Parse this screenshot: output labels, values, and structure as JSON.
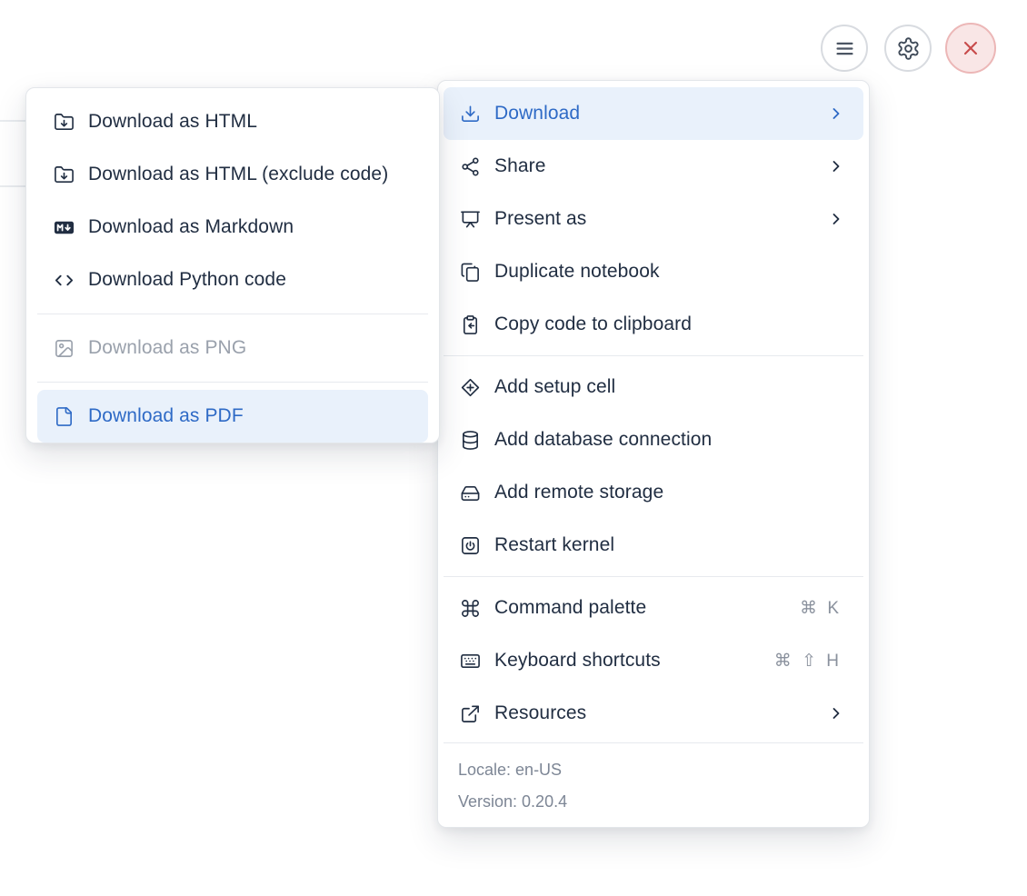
{
  "colors": {
    "accent_blue": "#2e6ac6",
    "highlight_bg": "#e9f1fb",
    "text": "#212e42",
    "muted": "#9aa1ac",
    "footer_text": "#7d8695",
    "danger": "#c84b4b",
    "danger_bg": "#f9e6e6"
  },
  "toolbar": {
    "buttons": [
      {
        "name": "menu",
        "icon": "hamburger-icon"
      },
      {
        "name": "settings",
        "icon": "gear-icon"
      },
      {
        "name": "close",
        "icon": "close-icon"
      }
    ]
  },
  "main_menu": {
    "items": [
      {
        "label": "Download",
        "icon": "download-icon",
        "has_submenu": true,
        "state": "active"
      },
      {
        "label": "Share",
        "icon": "share-icon",
        "has_submenu": true
      },
      {
        "label": "Present as",
        "icon": "presentation-icon",
        "has_submenu": true
      },
      {
        "label": "Duplicate notebook",
        "icon": "copy-pages-icon"
      },
      {
        "label": "Copy code to clipboard",
        "icon": "clipboard-arrow-icon"
      },
      {
        "label": "Add setup cell",
        "icon": "diamond-plus-icon"
      },
      {
        "label": "Add database connection",
        "icon": "database-icon"
      },
      {
        "label": "Add remote storage",
        "icon": "hard-drive-icon"
      },
      {
        "label": "Restart kernel",
        "icon": "power-square-icon"
      },
      {
        "label": "Command palette",
        "icon": "command-icon",
        "shortcut": "⌘ K"
      },
      {
        "label": "Keyboard shortcuts",
        "icon": "keyboard-icon",
        "shortcut": "⌘ ⇧ H"
      },
      {
        "label": "Resources",
        "icon": "external-link-icon",
        "has_submenu": true
      }
    ],
    "footer": {
      "locale": "Locale: en-US",
      "version": "Version: 0.20.4"
    }
  },
  "download_submenu": {
    "items": [
      {
        "label": "Download as HTML",
        "icon": "folder-download-icon"
      },
      {
        "label": "Download as HTML (exclude code)",
        "icon": "folder-download-icon"
      },
      {
        "label": "Download as Markdown",
        "icon": "markdown-icon"
      },
      {
        "label": "Download Python code",
        "icon": "code-icon"
      },
      {
        "label": "Download as PNG",
        "icon": "image-icon",
        "state": "disabled"
      },
      {
        "label": "Download as PDF",
        "icon": "file-icon",
        "state": "active"
      }
    ]
  }
}
